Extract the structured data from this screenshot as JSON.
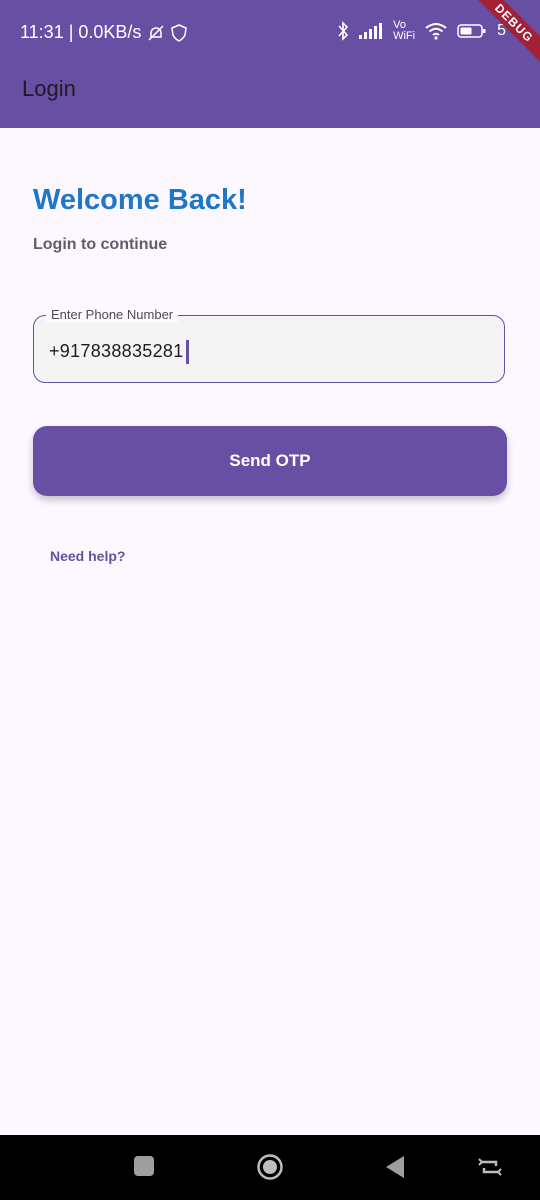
{
  "status_bar": {
    "time_and_speed": "11:31 | 0.0KB/s",
    "network_label_top": "Vo",
    "network_label_bottom": "WiFi",
    "battery_text": "5"
  },
  "debug_banner": "DEBUG",
  "app_bar": {
    "title": "Login"
  },
  "login": {
    "heading": "Welcome Back!",
    "subtitle": "Login to continue",
    "phone_label": "Enter Phone Number",
    "phone_value": "+917838835281",
    "send_button": "Send OTP",
    "help_link": "Need help?"
  },
  "colors": {
    "primary": "#6750a4",
    "heading_blue": "#1f77c9",
    "background": "#fdf7ff"
  },
  "icons": [
    "bell-off-icon",
    "shield-icon",
    "bluetooth-icon",
    "signal-icon",
    "wifi-icon",
    "battery-icon",
    "square-icon",
    "home-circle-icon",
    "back-triangle-icon",
    "rotate-icon"
  ]
}
